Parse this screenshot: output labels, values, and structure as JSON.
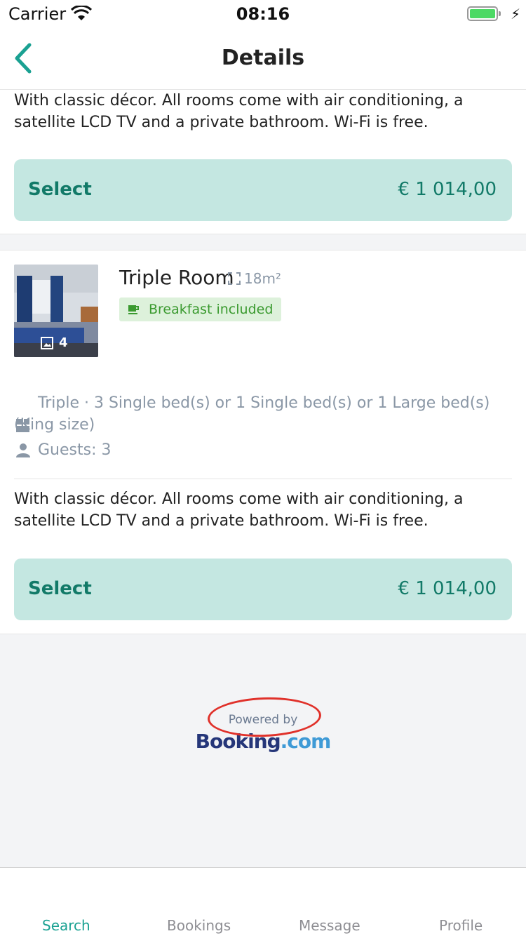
{
  "status_bar": {
    "carrier": "Carrier",
    "time": "08:16"
  },
  "nav": {
    "title": "Details",
    "back_icon": "chevron-left-icon"
  },
  "room_cards": [
    {
      "description": "With classic décor. All rooms come with air conditioning, a satellite LCD TV and a private bathroom. Wi-Fi is free.",
      "select_label": "Select",
      "price": "€ 1 014,00"
    },
    {
      "name": "Triple Room",
      "size": "18m²",
      "photo_count": "4",
      "badge": "Breakfast included",
      "bed_info": "Triple · 3 Single bed(s) or 1 Single bed(s) or 1 Large bed(s) (King size)",
      "guests": "Guests: 3",
      "description": "With classic décor. All rooms come with air conditioning, a satellite LCD TV and a private bathroom. Wi-Fi is free.",
      "select_label": "Select",
      "price": "€ 1 014,00"
    }
  ],
  "footer": {
    "powered_by": "Powered by",
    "logo_part1": "Booking",
    "logo_part2": ".com"
  },
  "tabs": [
    {
      "label": "Search",
      "active": true
    },
    {
      "label": "Bookings",
      "active": false
    },
    {
      "label": "Message",
      "active": false
    },
    {
      "label": "Profile",
      "active": false
    }
  ],
  "colors": {
    "accent": "#1aa192",
    "button_bg": "#c4e7e1",
    "button_text": "#127a68",
    "badge_bg": "#ddf1db",
    "badge_text": "#3a9a2f",
    "annotation_red": "#e0312a"
  }
}
